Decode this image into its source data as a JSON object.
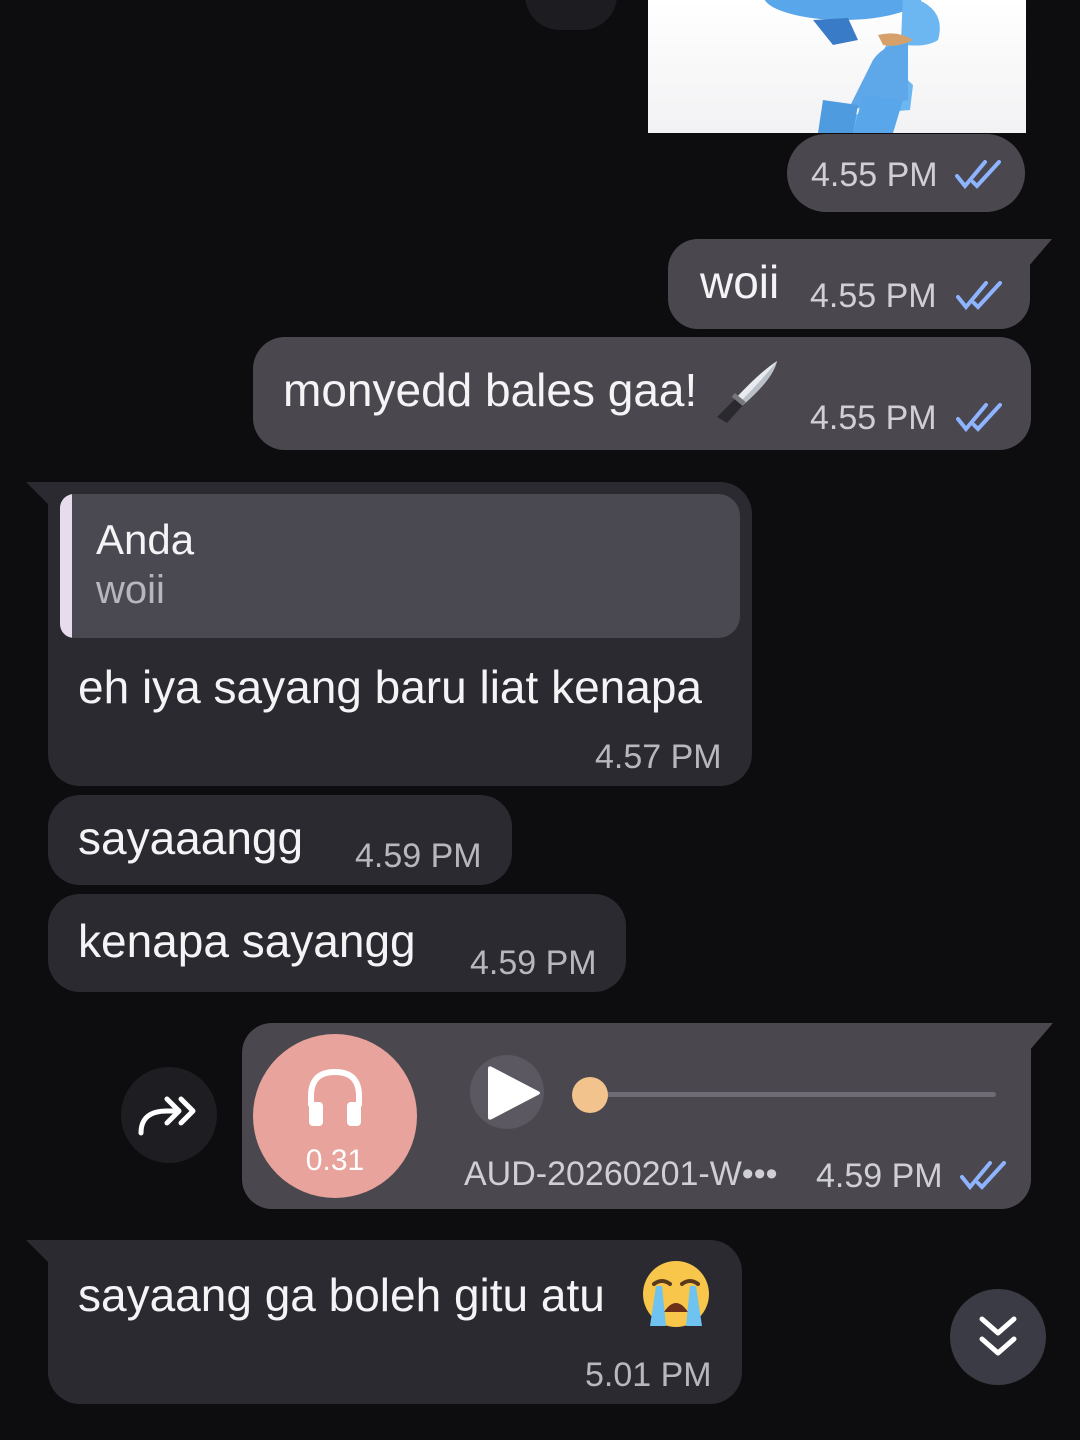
{
  "messages": {
    "sticker": {
      "time": "4.55 PM"
    },
    "woii": {
      "text": "woii",
      "time": "4.55 PM"
    },
    "monyedd": {
      "text": "monyedd bales gaa!",
      "time": "4.55 PM"
    },
    "reply": {
      "quote_author": "Anda",
      "quote_text": "woii",
      "text": "eh iya sayang baru liat kenapa",
      "time": "4.57 PM"
    },
    "sayaaangg": {
      "text": "sayaaangg",
      "time": "4.59 PM"
    },
    "kenapa": {
      "text": "kenapa sayangg",
      "time": "4.59 PM"
    },
    "audio": {
      "duration": "0.31",
      "filename": "AUD-20260201-W•••",
      "time": "4.59 PM",
      "progress": 0.0
    },
    "last": {
      "text": "sayaang ga boleh gitu atu",
      "time": "5.01 PM"
    }
  },
  "icons": {
    "read_receipt": "double-check-icon",
    "knife": "knife-emoji",
    "crying": "loudly-crying-emoji",
    "headphones": "headphones-icon",
    "play": "play-icon",
    "forward": "forward-icon",
    "scroll_down": "double-chevron-down-icon"
  },
  "colors": {
    "outgoing_bubble": "#4b474f",
    "incoming_bubble": "#2b2a30",
    "read_check": "#8fb4ff",
    "audio_circle": "#e8a49c",
    "seek_knob": "#f2c38d"
  }
}
